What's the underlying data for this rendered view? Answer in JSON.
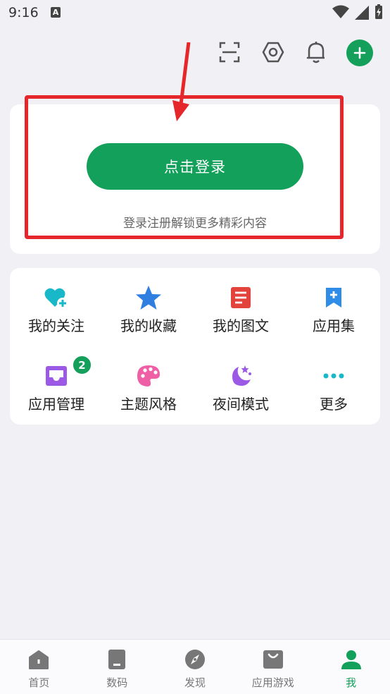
{
  "status": {
    "time": "9:16",
    "notif_letter": "A"
  },
  "login": {
    "button_label": "点击登录",
    "hint": "登录注册解锁更多精彩内容"
  },
  "menu": [
    {
      "label": "我的关注",
      "icon": "heart-plus-icon",
      "color": "#19b8c9"
    },
    {
      "label": "我的收藏",
      "icon": "star-icon",
      "color": "#2f7fe0"
    },
    {
      "label": "我的图文",
      "icon": "document-icon",
      "color": "#e2433a"
    },
    {
      "label": "应用集",
      "icon": "bookmark-plus-icon",
      "color": "#2f8de8"
    },
    {
      "label": "应用管理",
      "icon": "inbox-icon",
      "color": "#9b59e6",
      "badge": "2"
    },
    {
      "label": "主题风格",
      "icon": "palette-icon",
      "color": "#ef5fa6"
    },
    {
      "label": "夜间模式",
      "icon": "moon-star-icon",
      "color": "#9b59e6"
    },
    {
      "label": "更多",
      "icon": "more-dots-icon",
      "color": "#19b8c9"
    }
  ],
  "nav": [
    {
      "label": "首页",
      "icon": "home-icon"
    },
    {
      "label": "数码",
      "icon": "device-icon"
    },
    {
      "label": "发现",
      "icon": "compass-icon"
    },
    {
      "label": "应用游戏",
      "icon": "bag-icon"
    },
    {
      "label": "我",
      "icon": "person-icon",
      "active": true
    }
  ],
  "colors": {
    "accent": "#13a05a",
    "highlight": "#e5262a"
  }
}
